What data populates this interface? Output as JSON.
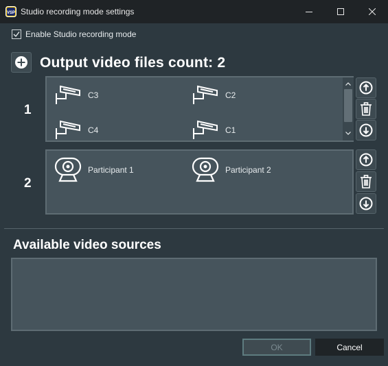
{
  "window": {
    "title": "Studio recording mode settings",
    "app_icon_text": "VSP",
    "buttons": [
      "minimize-icon",
      "maximize-icon",
      "close-icon"
    ]
  },
  "enable_checkbox": {
    "label": "Enable Studio recording mode",
    "checked": true
  },
  "output": {
    "heading": "Output video files count: 2"
  },
  "groups": [
    {
      "number": "1",
      "sources": [
        {
          "label": "C3",
          "icon": "security-camera-icon"
        },
        {
          "label": "C2",
          "icon": "security-camera-icon"
        },
        {
          "label": "C4",
          "icon": "security-camera-icon"
        },
        {
          "label": "C1",
          "icon": "security-camera-icon"
        }
      ],
      "has_scrollbar": true
    },
    {
      "number": "2",
      "sources": [
        {
          "label": "Participant 1",
          "icon": "webcam-icon"
        },
        {
          "label": "Participant 2",
          "icon": "webcam-icon"
        }
      ],
      "has_scrollbar": false
    }
  ],
  "available": {
    "heading": "Available video sources"
  },
  "dialog_buttons": {
    "ok": "OK",
    "cancel": "Cancel"
  },
  "colors": {
    "background": "#2d3940",
    "titlebar": "#1f2326",
    "panel": "#46545c",
    "panel_border": "#5e6c73",
    "ok_border": "#5e7c80"
  }
}
